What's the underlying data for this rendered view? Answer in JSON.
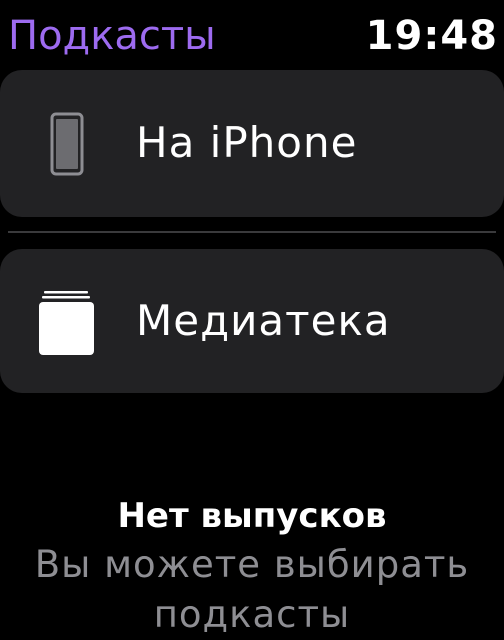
{
  "header": {
    "title": "Подкасты",
    "time": "19:48"
  },
  "rows": [
    {
      "label": "На iPhone",
      "icon": "iphone-icon"
    },
    {
      "label": "Медиатека",
      "icon": "library-stack-icon"
    }
  ],
  "empty_state": {
    "title": "Нет выпусков",
    "line1": "Вы можете выбирать",
    "line2": "подкасты"
  },
  "colors": {
    "accent": "#9d6bf0",
    "background": "#000000",
    "row_background": "#222224",
    "secondary_text": "#8e8e93"
  }
}
